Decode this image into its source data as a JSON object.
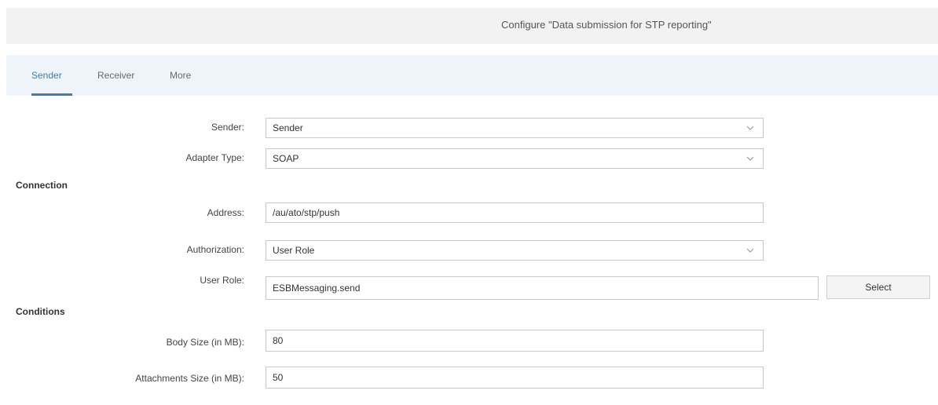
{
  "header": {
    "title": "Configure \"Data submission for STP reporting\""
  },
  "tabs": [
    {
      "label": "Sender"
    },
    {
      "label": "Receiver"
    },
    {
      "label": "More"
    }
  ],
  "form": {
    "sender": {
      "label": "Sender:",
      "value": "Sender"
    },
    "adapter_type": {
      "label": "Adapter Type:",
      "value": "SOAP"
    },
    "sections": {
      "connection": "Connection",
      "conditions": "Conditions"
    },
    "address": {
      "label": "Address:",
      "value": "/au/ato/stp/push"
    },
    "authorization": {
      "label": "Authorization:",
      "value": "User Role"
    },
    "user_role": {
      "label": "User Role:",
      "value": "ESBMessaging.send",
      "button": "Select"
    },
    "body_size": {
      "label": "Body Size (in MB):",
      "value": "80"
    },
    "attachments_size": {
      "label": "Attachments Size (in MB):",
      "value": "50"
    }
  },
  "icons": {
    "dropdown": "chevron-down-icon"
  },
  "colors": {
    "accent": "#427cac",
    "tab_bar_bg": "#eef4fa",
    "title_bar_bg": "#f2f2f2"
  }
}
